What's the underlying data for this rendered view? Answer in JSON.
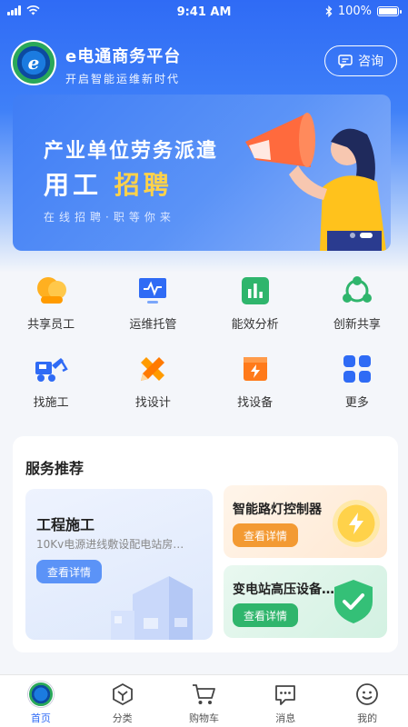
{
  "status": {
    "time": "9:41 AM",
    "battery": "100%"
  },
  "header": {
    "logo_text": "e",
    "title": "e电通商务平台",
    "subtitle": "开启智能运维新时代",
    "consult_label": "咨询"
  },
  "banner": {
    "line1": "产业单位劳务派遣",
    "line2_a": "用工",
    "line2_b": "招聘",
    "line3": "在线招聘·职等你来"
  },
  "grid": [
    {
      "label": "共享员工",
      "icon": "people-icon"
    },
    {
      "label": "运维托管",
      "icon": "monitor-icon"
    },
    {
      "label": "能效分析",
      "icon": "chart-icon"
    },
    {
      "label": "创新共享",
      "icon": "share-icon"
    },
    {
      "label": "找施工",
      "icon": "truck-icon"
    },
    {
      "label": "找设计",
      "icon": "ruler-pencil-icon"
    },
    {
      "label": "找设备",
      "icon": "device-box-icon"
    },
    {
      "label": "更多",
      "icon": "grid-icon"
    }
  ],
  "services": {
    "title": "服务推荐",
    "card1": {
      "title": "工程施工",
      "desc": "10Kv电源进线敷设配电站房…",
      "button": "查看详情"
    },
    "card2": {
      "title": "智能路灯控制器",
      "button": "查看详情"
    },
    "card3": {
      "title": "变电站高压设备…",
      "button": "查看详情"
    }
  },
  "tabs": [
    {
      "label": "首页",
      "icon": "home-logo-icon",
      "active": true
    },
    {
      "label": "分类",
      "icon": "category-icon"
    },
    {
      "label": "购物车",
      "icon": "cart-icon"
    },
    {
      "label": "消息",
      "icon": "message-icon"
    },
    {
      "label": "我的",
      "icon": "profile-icon"
    }
  ],
  "colors": {
    "primary": "#2f6bf5",
    "orange": "#f39a33",
    "green": "#2fb56c",
    "yellow": "#ffd24a"
  }
}
